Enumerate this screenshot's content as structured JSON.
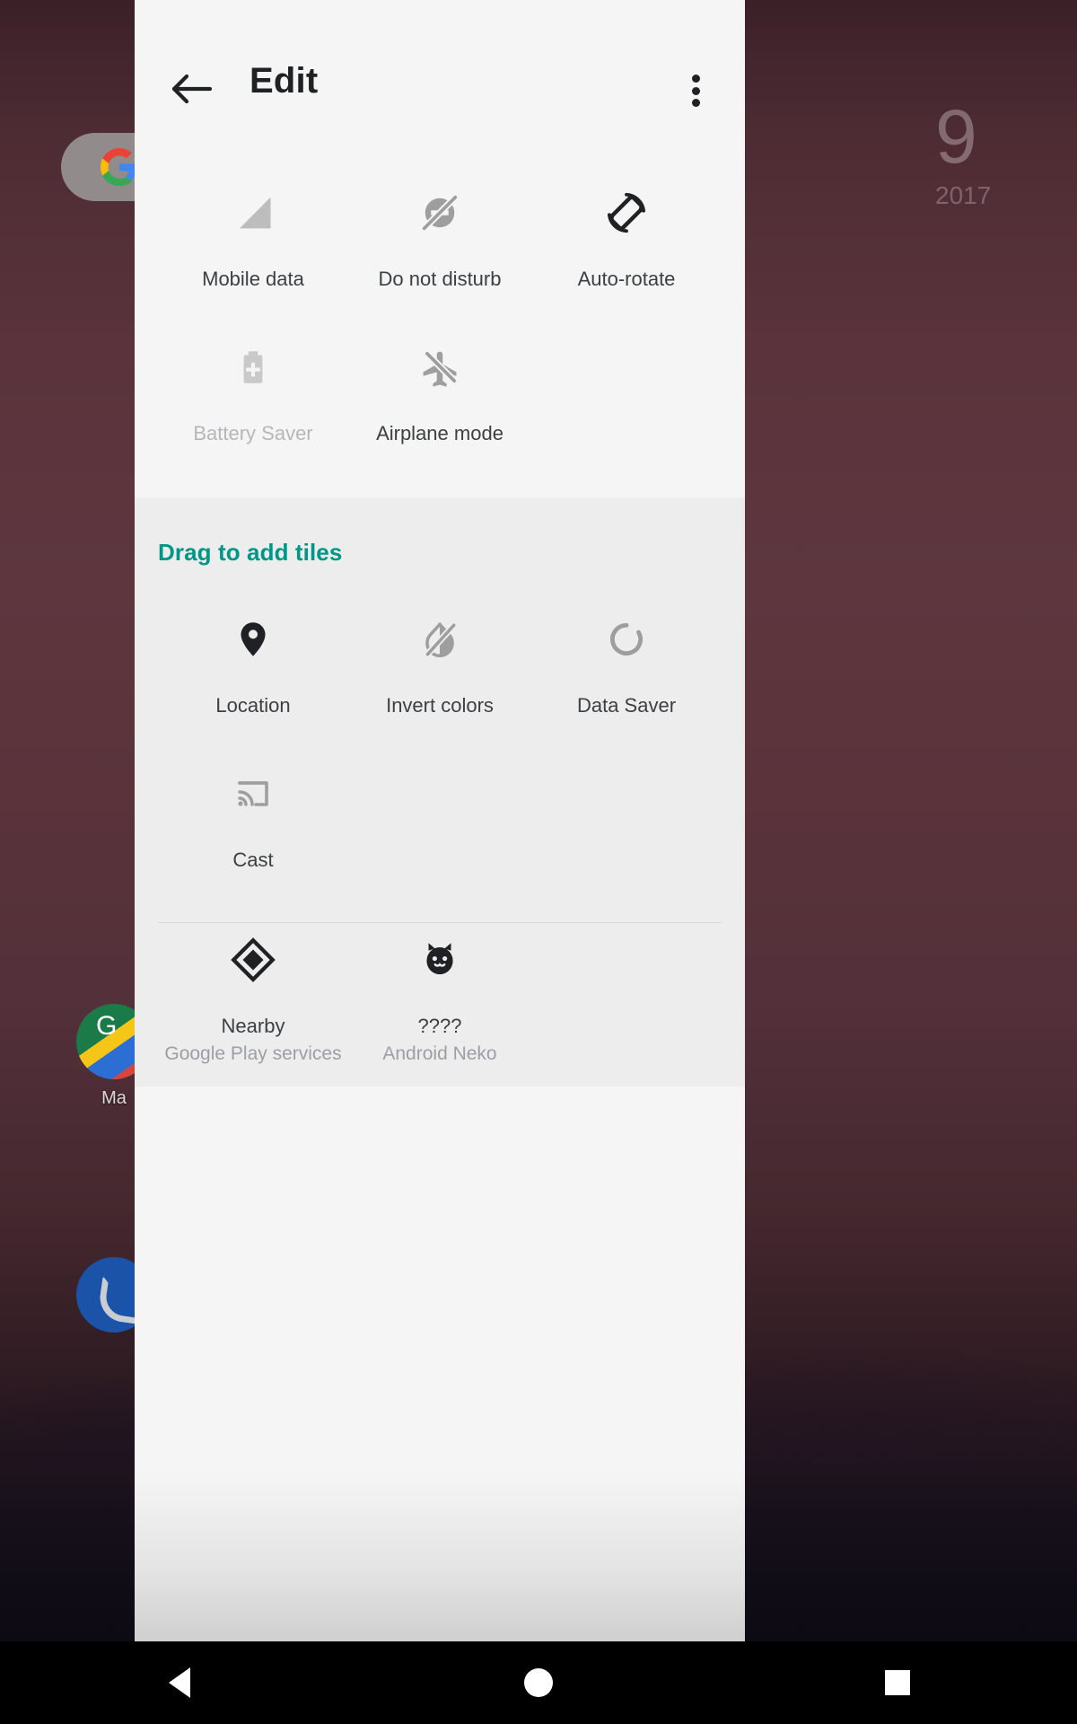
{
  "colors": {
    "accent": "#009688",
    "panel_bg": "#f5f5f5",
    "add_bg": "#ededed",
    "icon_active": "#202124",
    "icon_inactive": "#9aa0a6",
    "label": "#3c4043",
    "label_disabled": "#b4b7ba"
  },
  "header": {
    "title": "Edit",
    "back_icon": "arrow-back-icon",
    "menu_icon": "overflow-menu-icon"
  },
  "active_tiles": [
    {
      "label": "Mobile data",
      "icon": "signal-bar-icon",
      "state": "inactive"
    },
    {
      "label": "Do not disturb",
      "icon": "do-not-disturb-icon",
      "state": "inactive"
    },
    {
      "label": "Auto-rotate",
      "icon": "auto-rotate-icon",
      "state": "active"
    },
    {
      "label": "Battery Saver",
      "icon": "battery-saver-icon",
      "state": "disabled"
    },
    {
      "label": "Airplane mode",
      "icon": "airplane-off-icon",
      "state": "inactive"
    }
  ],
  "add_section": {
    "heading": "Drag to add tiles",
    "tiles": [
      {
        "label": "Location",
        "icon": "location-pin-icon",
        "state": "active"
      },
      {
        "label": "Invert colors",
        "icon": "invert-colors-icon",
        "state": "inactive"
      },
      {
        "label": "Data Saver",
        "icon": "data-saver-icon",
        "state": "inactive"
      },
      {
        "label": "Cast",
        "icon": "cast-icon",
        "state": "inactive"
      }
    ],
    "third_party_tiles": [
      {
        "label": "Nearby",
        "sublabel": "Google Play services",
        "icon": "nearby-diamond-icon",
        "state": "active"
      },
      {
        "label": "????",
        "sublabel": "Android Neko",
        "icon": "cat-face-icon",
        "state": "active"
      }
    ]
  },
  "wallpaper": {
    "date_widget": {
      "day": "9",
      "year": "2017"
    },
    "apps": [
      {
        "label": "Ma",
        "icon": "google-maps-icon"
      }
    ],
    "dock": [
      {
        "label": "",
        "icon": "phone-dialer-icon"
      }
    ],
    "search_icon": "google-g-icon"
  },
  "navbar": {
    "back": "nav-back-icon",
    "home": "nav-home-icon",
    "recents": "nav-recents-icon"
  }
}
